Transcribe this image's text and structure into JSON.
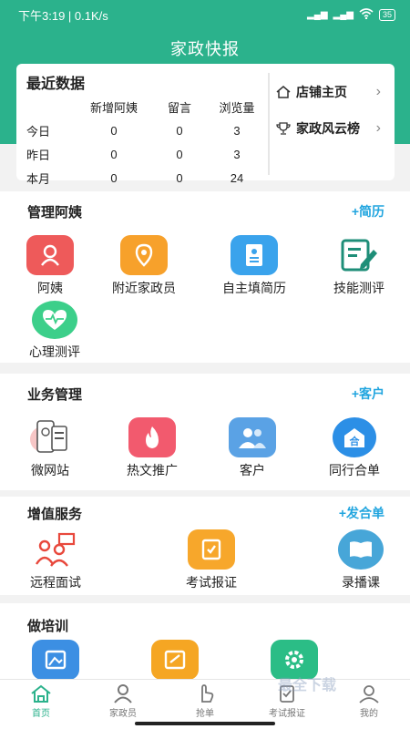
{
  "status": {
    "time_speed": "下午3:19 | 0.1K/s",
    "battery": "35"
  },
  "header": {
    "title": "家政快报"
  },
  "recent": {
    "title": "最近数据",
    "columns": [
      "",
      "新增阿姨",
      "留言",
      "浏览量"
    ],
    "rows": [
      {
        "label": "今日",
        "values": [
          "0",
          "0",
          "3"
        ]
      },
      {
        "label": "昨日",
        "values": [
          "0",
          "0",
          "3"
        ]
      },
      {
        "label": "本月",
        "values": [
          "0",
          "0",
          "24"
        ]
      }
    ]
  },
  "shop_links": [
    {
      "label": "店铺主页",
      "icon": "home-icon"
    },
    {
      "label": "家政风云榜",
      "icon": "trophy-icon"
    }
  ],
  "sections": {
    "manage": {
      "title": "管理阿姨",
      "action": "+简历",
      "items": [
        {
          "label": "阿姨",
          "icon": "nanny-icon",
          "color": "#ee5a5a"
        },
        {
          "label": "附近家政员",
          "icon": "location-icon",
          "color": "#f7a12b"
        },
        {
          "label": "自主填简历",
          "icon": "resume-icon",
          "color": "#3aa3ec"
        },
        {
          "label": "技能测评",
          "icon": "edit-icon",
          "color": "#1e8e78"
        },
        {
          "label": "心理测评",
          "icon": "heart-icon",
          "color": "#3ccf8a"
        }
      ]
    },
    "business": {
      "title": "业务管理",
      "action": "+客户",
      "items": [
        {
          "label": "微网站",
          "icon": "website-icon",
          "color": "#f5b8b8"
        },
        {
          "label": "热文推广",
          "icon": "fire-icon",
          "color": "#f25a6e"
        },
        {
          "label": "客户",
          "icon": "customers-icon",
          "color": "#5aa2e5"
        },
        {
          "label": "同行合单",
          "icon": "merge-icon",
          "color": "#2c8fe6"
        }
      ]
    },
    "value_added": {
      "title": "增值服务",
      "action": "+发合单",
      "items": [
        {
          "label": "远程面试",
          "icon": "interview-icon",
          "color": "#e8483c"
        },
        {
          "label": "考试报证",
          "icon": "exam-icon",
          "color": "#f7a72b"
        },
        {
          "label": "录播课",
          "icon": "book-icon",
          "color": "#47a6d8"
        }
      ]
    },
    "training": {
      "title": "做培训",
      "items": [
        {
          "label": "",
          "icon": "gallery-icon",
          "color": "#3c8fe3"
        },
        {
          "label": "",
          "icon": "sign-icon",
          "color": "#f5a623"
        },
        {
          "label": "",
          "icon": "settings-icon",
          "color": "#2bbd86"
        }
      ]
    }
  },
  "tabs": [
    {
      "label": "首页",
      "icon": "home-icon",
      "active": true
    },
    {
      "label": "家政员",
      "icon": "person-icon"
    },
    {
      "label": "抢单",
      "icon": "hand-icon"
    },
    {
      "label": "考试报证",
      "icon": "exam-icon"
    },
    {
      "label": "我的",
      "icon": "user-icon"
    }
  ],
  "watermark": "最全下载"
}
